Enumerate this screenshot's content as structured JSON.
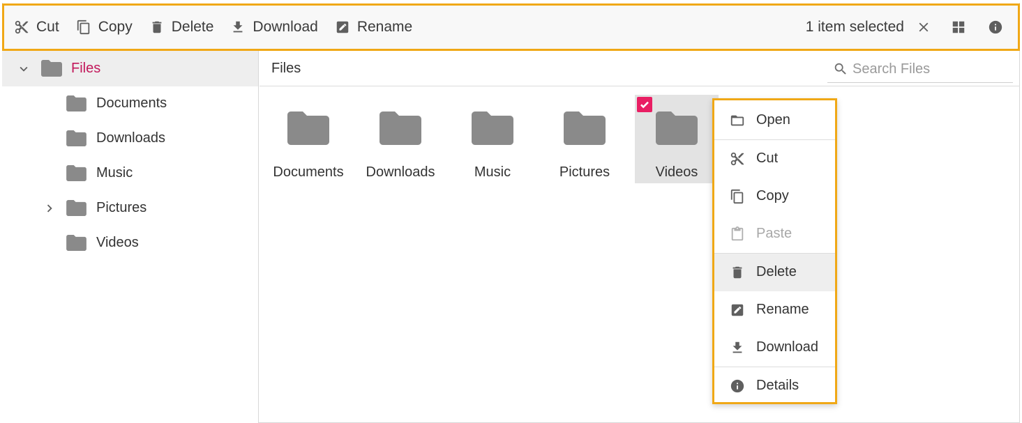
{
  "toolbar": {
    "items": [
      {
        "label": "Cut",
        "icon": "scissors-icon"
      },
      {
        "label": "Copy",
        "icon": "copy-icon"
      },
      {
        "label": "Delete",
        "icon": "trash-icon"
      },
      {
        "label": "Download",
        "icon": "download-icon"
      },
      {
        "label": "Rename",
        "icon": "rename-icon"
      }
    ],
    "selection_text": "1 item selected",
    "close_icon": "close-icon",
    "view_icon": "grid-view-icon",
    "details_icon": "info-icon"
  },
  "navigation": {
    "root": {
      "label": "Files",
      "icon": "folder-icon",
      "expanded": true
    },
    "items": [
      {
        "label": "Documents",
        "has_children": false
      },
      {
        "label": "Downloads",
        "has_children": false
      },
      {
        "label": "Music",
        "has_children": false
      },
      {
        "label": "Pictures",
        "has_children": true
      },
      {
        "label": "Videos",
        "has_children": false
      }
    ]
  },
  "address_bar": {
    "breadcrumb": "Files",
    "search_placeholder": "Search Files"
  },
  "files": [
    {
      "label": "Documents",
      "selected": false
    },
    {
      "label": "Downloads",
      "selected": false
    },
    {
      "label": "Music",
      "selected": false
    },
    {
      "label": "Pictures",
      "selected": false
    },
    {
      "label": "Videos",
      "selected": true
    }
  ],
  "context_menu": {
    "items": [
      {
        "label": "Open",
        "icon": "open-folder-icon",
        "disabled": false
      },
      {
        "label": "Cut",
        "icon": "scissors-icon",
        "disabled": false
      },
      {
        "label": "Copy",
        "icon": "copy-icon",
        "disabled": false
      },
      {
        "label": "Paste",
        "icon": "paste-icon",
        "disabled": true
      },
      {
        "label": "Delete",
        "icon": "trash-icon",
        "disabled": false,
        "hovered": true
      },
      {
        "label": "Rename",
        "icon": "rename-icon",
        "disabled": false
      },
      {
        "label": "Download",
        "icon": "download-icon",
        "disabled": false
      },
      {
        "label": "Details",
        "icon": "info-icon",
        "disabled": false
      }
    ]
  },
  "colors": {
    "accent": "#c2185b",
    "highlight_border": "#f0a816",
    "checkbox": "#e91e63",
    "folder": "#8a8a8a"
  }
}
